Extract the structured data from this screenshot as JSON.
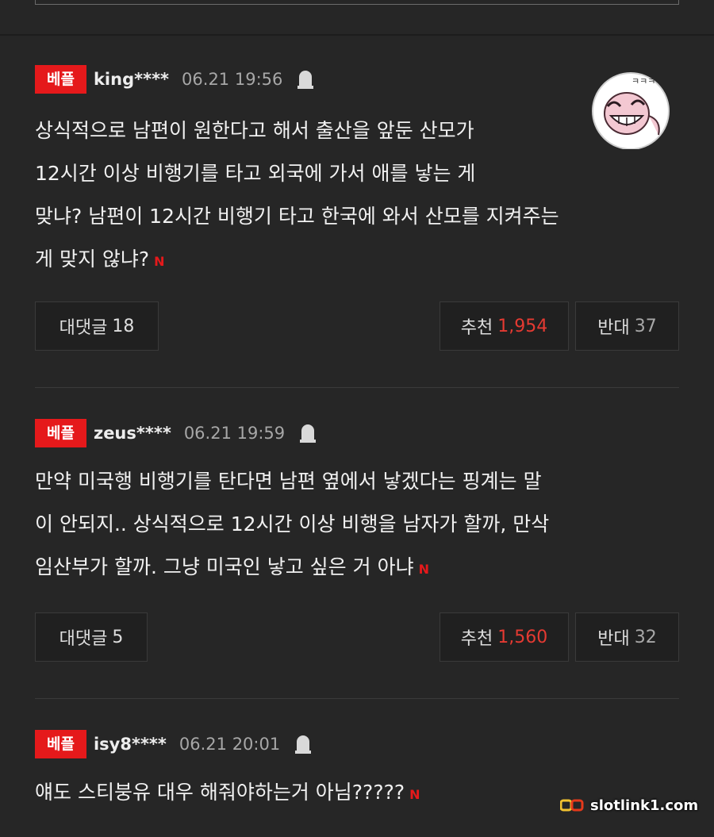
{
  "comments": [
    {
      "badge": "베플",
      "user": "king****",
      "date": "06.21 19:56",
      "lines": [
        "상식적으로 남편이 원한다고 해서 출산을 앞둔 산모가",
        "12시간 이상 비행기를 타고 외국에 가서 애를 낳는 게",
        "맞냐? 남편이 12시간 비행기 타고 한국에 와서 산모를 지켜주는",
        "게 맞지 않냐?"
      ],
      "reply_label": "대댓글",
      "reply_count": "18",
      "like_label": "추천",
      "like_count": "1,954",
      "dislike_label": "반대",
      "dislike_count": "37"
    },
    {
      "badge": "베플",
      "user": "zeus****",
      "date": "06.21 19:59",
      "lines": [
        "만약 미국행 비행기를 탄다면 남편 옆에서 낳겠다는 핑계는 말",
        "이 안되지.. 상식적으로 12시간 이상 비행을 남자가 할까, 만삭",
        "임산부가 할까. 그냥 미국인 낳고 싶은 거 아냐"
      ],
      "reply_label": "대댓글",
      "reply_count": "5",
      "like_label": "추천",
      "like_count": "1,560",
      "dislike_label": "반대",
      "dislike_count": "32"
    },
    {
      "badge": "베플",
      "user": "isy8****",
      "date": "06.21 20:01",
      "lines": [
        "얘도 스티붕유 대우 해줘야하는거 아님?????"
      ]
    }
  ],
  "new_mark": "N",
  "avatar_caption": "ㅋㅋㅋ",
  "watermark": "slotlink1.com",
  "icons": {
    "report": "ghost-icon",
    "avatar": "laughing-face-icon",
    "watermark": "link-logo-icon"
  },
  "colors": {
    "badge": "#e5191b",
    "like_count": "#e53a32",
    "background": "#262626"
  }
}
